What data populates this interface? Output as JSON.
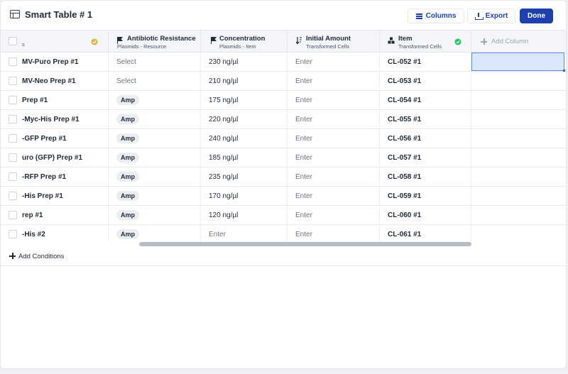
{
  "header": {
    "title": "Smart Table # 1",
    "columns_label": "Columns",
    "export_label": "Export",
    "done_label": "Done"
  },
  "columns": [
    {
      "name": "",
      "sub": "s",
      "icon": "check-circle-icon",
      "status_color": "#e0b33a"
    },
    {
      "name": "Antibiotic Resistance",
      "sub": "Plasmids - Resource",
      "icon": "flag-icon"
    },
    {
      "name": "Concentration",
      "sub": "Plasmids - Item",
      "icon": "flag-icon"
    },
    {
      "name": "Initial Amount",
      "sub": "Transformed Cells",
      "icon": "sort-icon"
    },
    {
      "name": "Item",
      "sub": "Transformed Cells",
      "icon": "boxes-icon",
      "status_color": "#22c55e"
    }
  ],
  "add_column_label": "Add Column",
  "rows": [
    {
      "name": "MV-Puro Prep #1",
      "resistance": "Select",
      "concentration": "230 ng/µl",
      "amount": "Enter",
      "item": "CL-052 #1"
    },
    {
      "name": "MV-Neo Prep #1",
      "resistance": "Select",
      "concentration": "210 ng/µl",
      "amount": "Enter",
      "item": "CL-053 #1"
    },
    {
      "name": "Prep #1",
      "resistance": "Amp",
      "concentration": "175 ng/µl",
      "amount": "Enter",
      "item": "CL-054 #1"
    },
    {
      "name": "-Myc-His Prep #1",
      "resistance": "Amp",
      "concentration": "220 ng/µl",
      "amount": "Enter",
      "item": "CL-055 #1"
    },
    {
      "name": "-GFP Prep #1",
      "resistance": "Amp",
      "concentration": "240 ng/µl",
      "amount": "Enter",
      "item": "CL-056 #1"
    },
    {
      "name": "uro (GFP) Prep #1",
      "resistance": "Amp",
      "concentration": "185 ng/µl",
      "amount": "Enter",
      "item": "CL-057 #1"
    },
    {
      "name": "-RFP Prep #1",
      "resistance": "Amp",
      "concentration": "235 ng/µl",
      "amount": "Enter",
      "item": "CL-058 #1"
    },
    {
      "name": "-His Prep #1",
      "resistance": "Amp",
      "concentration": "170 ng/µl",
      "amount": "Enter",
      "item": "CL-059 #1"
    },
    {
      "name": "rep #1",
      "resistance": "Amp",
      "concentration": "120 ng/µl",
      "amount": "Enter",
      "item": "CL-060 #1"
    },
    {
      "name": "-His #2",
      "resistance": "Amp",
      "concentration": "Enter",
      "amount": "Enter",
      "item": "CL-061 #1"
    }
  ],
  "footer": {
    "add_conditions_label": "Add Conditions"
  }
}
